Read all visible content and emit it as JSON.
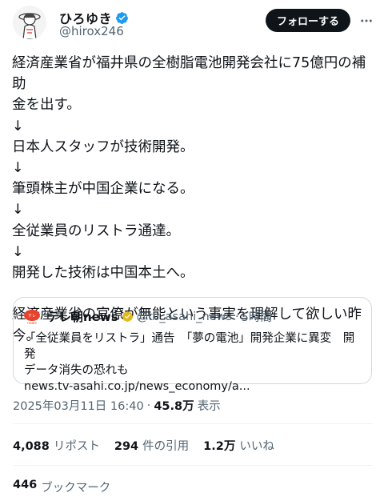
{
  "author": {
    "display_name": "ひろゆき",
    "handle": "@hirox246"
  },
  "follow_button_label": "フォローする",
  "tweet_lines": [
    "経済産業省が福井県の全樹脂電池開発会社に75億円の補助",
    "金を出す。",
    "↓",
    "日本人スタッフが技術開発。",
    "↓",
    "筆頭株主が中国企業になる。",
    "↓",
    "全従業員のリストラ通達。",
    "↓",
    "開発した技術は中国本土へ。",
    "",
    "経済産業省の官僚が無能という事実を理解して欲しい昨",
    "今。"
  ],
  "quote": {
    "name": "テレ朝news",
    "handle": "@tv_asahi_news",
    "separator": "·",
    "time": "5時間",
    "body_line1": "「全従業員をリストラ」通告　「夢の電池」開発企業に異変　開発",
    "body_line2": "データ消失の恐れも",
    "url": "news.tv-asahi.co.jp/news_economy/a..."
  },
  "timestamp": {
    "datetime": "2025年03月11日 16:40",
    "separator": "·",
    "views": "45.8万",
    "views_label": "表示"
  },
  "stats": {
    "reposts": "4,088",
    "reposts_label": "リポスト",
    "quotes": "294",
    "quotes_label": "件の引用",
    "likes": "1.2万",
    "likes_label": "いいね"
  },
  "bookmarks": {
    "count": "446",
    "label": "ブックマーク"
  },
  "colors": {
    "verified_blue": "#1d9bf0",
    "business_gold": "#e2b719",
    "secondary_text": "#536471",
    "follow_button": "#0f1419"
  }
}
